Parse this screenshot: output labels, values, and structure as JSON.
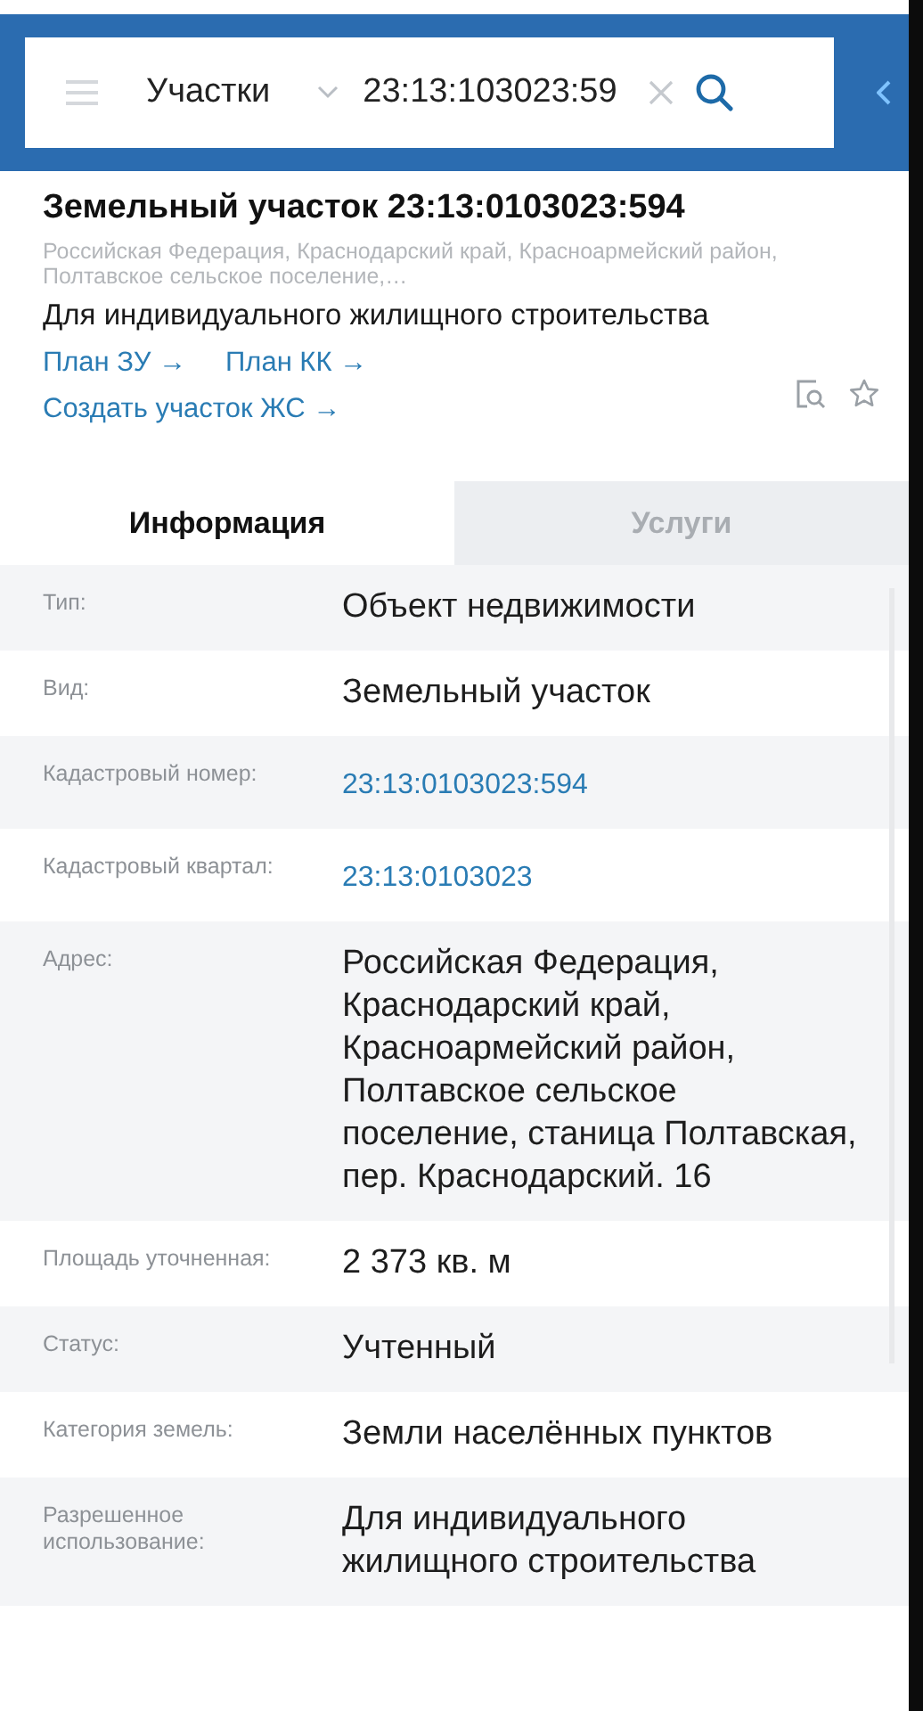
{
  "search_bar": {
    "category": "Участки",
    "value": "23:13:103023:59"
  },
  "header": {
    "title": "Земельный участок 23:13:0103023:594",
    "address": "Российская Федерация, Краснодарский край, Красноармейский район, Полтавское сельское поселение,…",
    "purpose": "Для индивидуального жилищного строительства",
    "links": [
      "План ЗУ →",
      "План КК →",
      "Создать участок ЖС →"
    ]
  },
  "tabs": [
    {
      "label": "Информация",
      "selected": true
    },
    {
      "label": "Услуги",
      "selected": false
    }
  ],
  "rows": [
    {
      "label": "Тип:",
      "value": "Объект недвижимости",
      "kind": "text"
    },
    {
      "label": "Вид:",
      "value": "Земельный участок",
      "kind": "text"
    },
    {
      "label": "Кадастровый номер:",
      "value": "23:13:0103023:594",
      "kind": "link"
    },
    {
      "label": "Кадастровый квартал:",
      "value": "23:13:0103023",
      "kind": "link"
    },
    {
      "label": "Адрес:",
      "value": "Российская Федерация, Краснодарский край, Красноармейский район, Полтавское сельское поселение, станица Полтавская, пер. Краснодарский. 16",
      "kind": "text"
    },
    {
      "label": "Площадь уточненная:",
      "value": "2 373 кв. м",
      "kind": "text"
    },
    {
      "label": "Статус:",
      "value": "Учтенный",
      "kind": "text"
    },
    {
      "label": "Категория земель:",
      "value": "Земли населённых пунктов",
      "kind": "text"
    },
    {
      "label": "Разрешенное использование:",
      "value": "Для индивидуального жилищного строительства",
      "kind": "text"
    }
  ]
}
